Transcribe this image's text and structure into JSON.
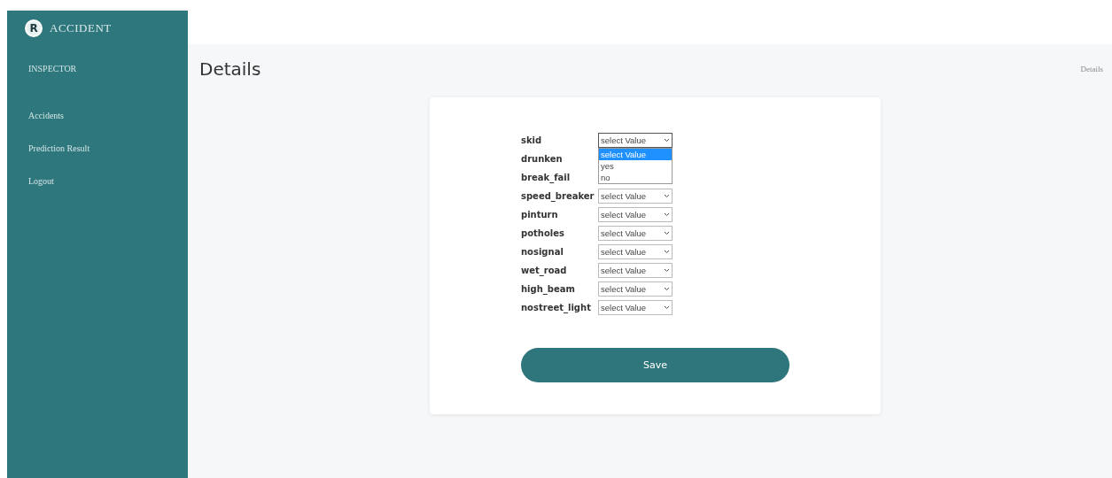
{
  "sidebar": {
    "logo_letter": "R",
    "brand": "ACCIDENT",
    "role": "INSPECTOR",
    "items": [
      {
        "label": "Accidents",
        "selected": false
      },
      {
        "label": "Prediction Result",
        "selected": false
      },
      {
        "label": "Logout",
        "selected": false
      }
    ]
  },
  "header": {
    "title": "Details",
    "breadcrumb": "Details"
  },
  "form": {
    "fields": [
      {
        "label": "skid",
        "value": "select Value",
        "open": true
      },
      {
        "label": "drunken"
      },
      {
        "label": "break_fail"
      },
      {
        "label": "speed_breaker",
        "value": "select Value",
        "open": false
      },
      {
        "label": "pinturn",
        "value": "select Value",
        "open": false
      },
      {
        "label": "potholes",
        "value": "select Value",
        "open": false
      },
      {
        "label": "nosignal",
        "value": "select Value",
        "open": false
      },
      {
        "label": "wet_road",
        "value": "select Value",
        "open": false
      },
      {
        "label": "high_beam",
        "value": "select Value",
        "open": false
      },
      {
        "label": "nostreet_light",
        "value": "select Value",
        "open": false
      }
    ],
    "dropdown_options": [
      {
        "label": "select Value",
        "selected": true
      },
      {
        "label": "yes",
        "selected": false
      },
      {
        "label": "no",
        "selected": false
      }
    ],
    "save_button": "Save"
  }
}
